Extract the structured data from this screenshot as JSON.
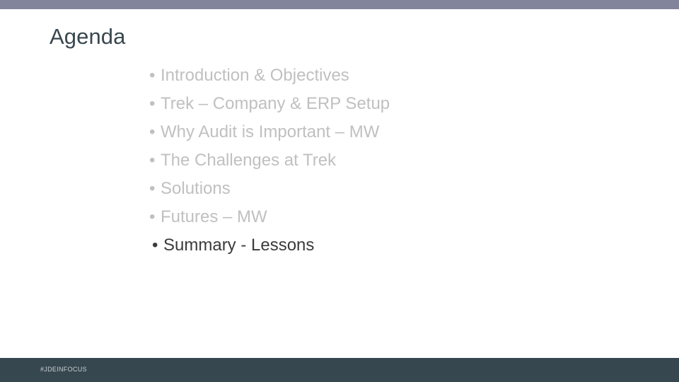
{
  "slide": {
    "title": "Agenda",
    "top_bar_color": "#82849c",
    "title_color": "#39474f",
    "background_color": "#ffffff",
    "bullet_glyph": "•",
    "items": [
      {
        "label": "Introduction & Objectives",
        "emphasis": false,
        "color": "#c0c0c0"
      },
      {
        "label": "Trek – Company & ERP Setup",
        "emphasis": false,
        "color": "#c0c0c0"
      },
      {
        "label": "Why Audit is Important – MW",
        "emphasis": false,
        "color": "#c0c0c0"
      },
      {
        "label": "The Challenges at Trek",
        "emphasis": false,
        "color": "#c0c0c0"
      },
      {
        "label": "Solutions",
        "emphasis": false,
        "color": "#c0c0c0"
      },
      {
        "label": "Futures – MW",
        "emphasis": false,
        "color": "#c0c0c0"
      },
      {
        "label": "Summary - Lessons",
        "emphasis": true,
        "color": "#3b3b3b"
      }
    ]
  },
  "footer": {
    "hashtag": "#JDEINFOCUS",
    "bar_color": "#37474f",
    "text_color": "#c9d1d4"
  }
}
